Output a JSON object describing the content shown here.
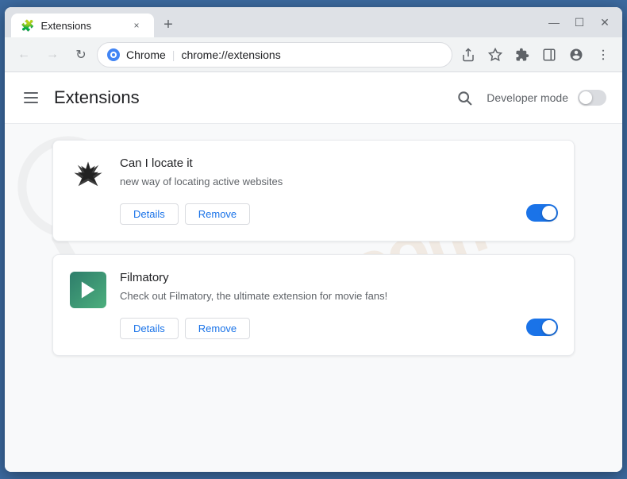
{
  "browser": {
    "tab": {
      "title": "Extensions",
      "icon": "🧩",
      "close_label": "×"
    },
    "new_tab_label": "+",
    "window_controls": {
      "minimize": "—",
      "maximize": "☐",
      "close": "✕"
    },
    "toolbar": {
      "back_label": "←",
      "forward_label": "→",
      "reload_label": "↻",
      "favicon_text": "C",
      "domain": "Chrome",
      "address": "chrome://extensions",
      "separator": "|"
    }
  },
  "page": {
    "title": "Extensions",
    "search_label": "🔍",
    "developer_mode_label": "Developer mode",
    "extensions": [
      {
        "id": "ext-1",
        "name": "Can I locate it",
        "description": "new way of locating active websites",
        "enabled": true,
        "details_label": "Details",
        "remove_label": "Remove"
      },
      {
        "id": "ext-2",
        "name": "Filmatory",
        "description": "Check out Filmatory, the ultimate extension for movie fans!",
        "enabled": true,
        "details_label": "Details",
        "remove_label": "Remove"
      }
    ]
  }
}
